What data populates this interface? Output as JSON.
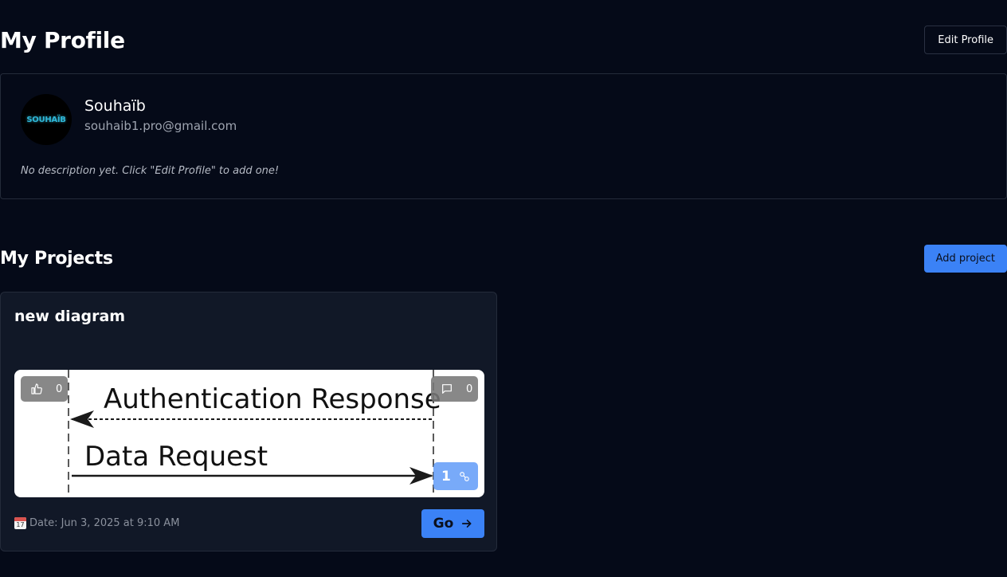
{
  "profile_section": {
    "title": "My Profile",
    "edit_button": "Edit Profile"
  },
  "profile": {
    "avatar_text": "SOUHAÏB",
    "name": "Souhaïb",
    "email": "souhaib1.pro@gmail.com",
    "description": "No description yet. Click \"Edit Profile\" to add one!"
  },
  "projects_section": {
    "title": "My Projects",
    "add_button": "Add project"
  },
  "projects": [
    {
      "title": "new diagram",
      "preview": {
        "message_top": "Authentication Response",
        "message_bottom": "Data Request"
      },
      "likes": "0",
      "comments": "0",
      "forks": "1",
      "date": "Date: Jun 3, 2025 at 9:10 AM",
      "date_icon_day": "17",
      "go_label": "Go"
    }
  ],
  "colors": {
    "background": "#050a18",
    "card": "#111827",
    "accent": "#3b82f6",
    "border": "#242b3a"
  },
  "icons": {
    "like": "thumbs-up-icon",
    "comment": "comment-icon",
    "fork": "fork-icon",
    "date": "calendar-icon",
    "go": "arrow-right-icon"
  }
}
